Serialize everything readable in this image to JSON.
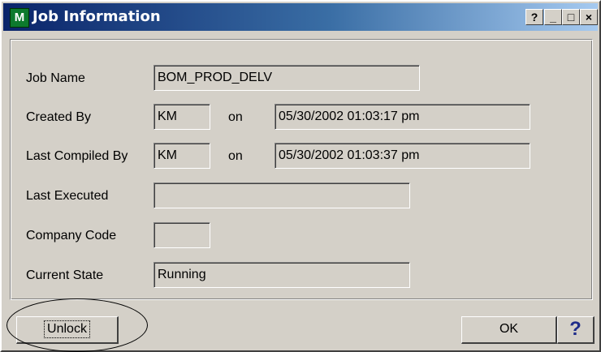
{
  "window": {
    "title": "Job Information",
    "icon": "app-m-icon",
    "controls": {
      "help": "?",
      "minimize": "_",
      "maximize": "□",
      "close": "×"
    }
  },
  "form": {
    "job_name": {
      "label": "Job Name",
      "value": "BOM_PROD_DELV"
    },
    "created_by": {
      "label": "Created By",
      "value": "KM",
      "on_label": "on",
      "date": "05/30/2002 01:03:17 pm"
    },
    "last_compiled_by": {
      "label": "Last Compiled By",
      "value": "KM",
      "on_label": "on",
      "date": "05/30/2002 01:03:37 pm"
    },
    "last_executed": {
      "label": "Last Executed",
      "value": ""
    },
    "company_code": {
      "label": "Company Code",
      "value": ""
    },
    "current_state": {
      "label": "Current State",
      "value": "Running"
    }
  },
  "buttons": {
    "unlock": "Unlock",
    "ok": "OK",
    "help": "?"
  },
  "colors": {
    "title_start": "#0a246a",
    "title_end": "#a6caf0",
    "face": "#d4d0c8",
    "help_glyph": "#1f2d8a"
  }
}
